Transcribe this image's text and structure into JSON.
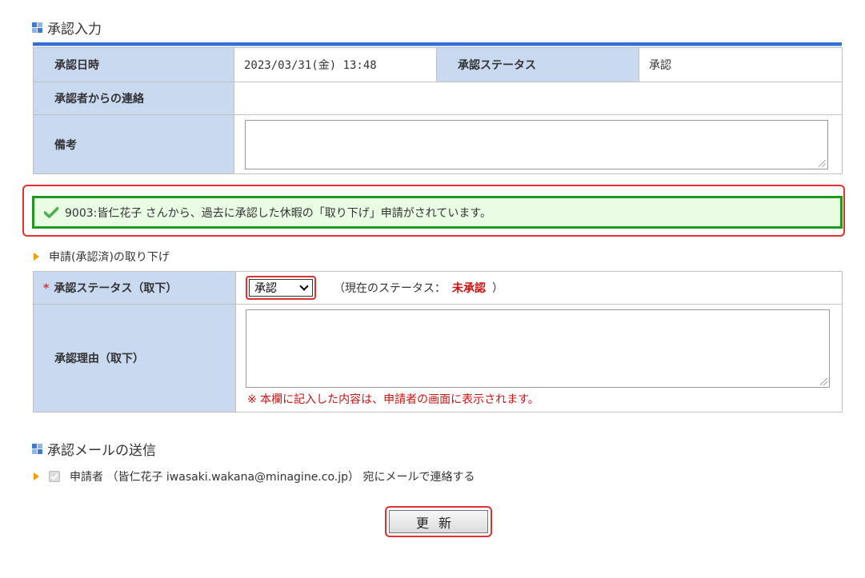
{
  "approval_section": {
    "title": "承認入力",
    "rows": {
      "date_label": "承認日時",
      "date_value": "2023/03/31(金) 13:48",
      "status_label": "承認ステータス",
      "status_value": "承認",
      "message_label": "承認者からの連絡",
      "remarks_label": "備考"
    }
  },
  "notice": {
    "text": "9003:皆仁花子 さんから、過去に承認した休暇の「取り下げ」申請がされています。"
  },
  "withdraw_section": {
    "title": "申請(承認済)の取り下げ",
    "required_mark": "*",
    "status_label": "承認ステータス（取下）",
    "select_value": "承認",
    "current_status_prefix": "（現在のステータス：",
    "current_status_value": "未承認",
    "current_status_suffix": "）",
    "reason_label": "承認理由（取下）",
    "reason_note": "※ 本欄に記入した内容は、申請者の画面に表示されます。"
  },
  "mail_section": {
    "title": "承認メールの送信",
    "recipient_text": "申請者 （皆仁花子 iwasaki.wakana@minagine.co.jp） 宛にメールで連絡する"
  },
  "actions": {
    "update_label": "更新"
  },
  "colors": {
    "label_bg": "#c9daf0",
    "accent_blue": "#2f6fd6",
    "notice_green": "#1f9a1f",
    "alert_red": "#e03030"
  }
}
